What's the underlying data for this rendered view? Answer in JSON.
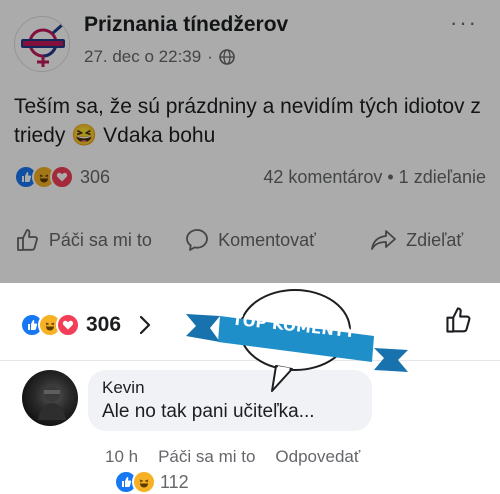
{
  "post": {
    "page_name": "Priznania tínedžerov",
    "timestamp": "27. dec o 22:39",
    "separator": "·",
    "privacy_icon": "globe-icon",
    "more_label": "···",
    "text": "Teším sa, že sú prázdniny a nevidím tých idiotov z triedy 😆 Vdaka bohu",
    "reaction_count": "306",
    "comments_shares": "42 komentárov • 1 zdieľanie",
    "actions": {
      "like": "Páči sa mi to",
      "comment": "Komentovať",
      "share": "Zdieľať"
    }
  },
  "sheet": {
    "reaction_count": "306",
    "banner_label": "TOP KOMENTY",
    "comment": {
      "author": "Kevin",
      "text": "Ale no tak pani učiteľka...",
      "time": "10 h",
      "like_label": "Páči sa mi to",
      "reply_label": "Odpovedať",
      "reaction_count": "112"
    }
  },
  "colors": {
    "like_blue": "#1877f2",
    "haha_yellow": "#f7b125",
    "love_red": "#f33e58",
    "banner_blue": "#1f8fc9"
  }
}
